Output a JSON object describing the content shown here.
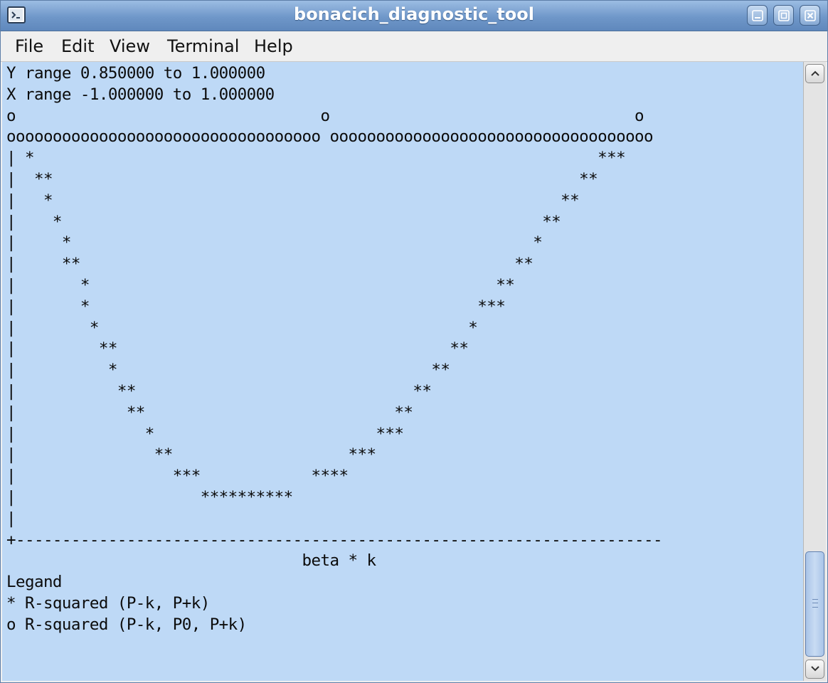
{
  "window": {
    "title": "bonacich_diagnostic_tool"
  },
  "menu": {
    "items": [
      "File",
      "Edit",
      "View",
      "Terminal",
      "Help"
    ]
  },
  "terminal": {
    "lines": [
      "Y range 0.850000 to 1.000000",
      "X range -1.000000 to 1.000000",
      "o                                 o                                 o",
      "oooooooooooooooooooooooooooooooooo ooooooooooooooooooooooooooooooooooo",
      "| *                                                             ***",
      "|  **                                                         **",
      "|   *                                                       **",
      "|    *                                                    **",
      "|     *                                                  *",
      "|     **                                               **",
      "|       *                                            **",
      "|       *                                          ***",
      "|        *                                        *",
      "|         **                                    **",
      "|          *                                  **",
      "|           **                              **",
      "|            **                           **",
      "|              *                        ***",
      "|               **                   ***",
      "|                 ***            ****",
      "|                    **********",
      "|",
      "+----------------------------------------------------------------------",
      "                                beta * k",
      "Legand",
      "* R-squared (P-k, P+k)",
      "o R-squared (P-k, P0, P+k)"
    ]
  },
  "colors": {
    "terminal_background": "#bed9f6",
    "titlebar": "#6f97c9"
  },
  "icons": {
    "app": "terminal-icon",
    "minimize": "minimize-icon",
    "maximize": "maximize-icon",
    "close": "close-icon",
    "scroll_up": "chevron-up-icon",
    "scroll_down": "chevron-down-icon"
  }
}
